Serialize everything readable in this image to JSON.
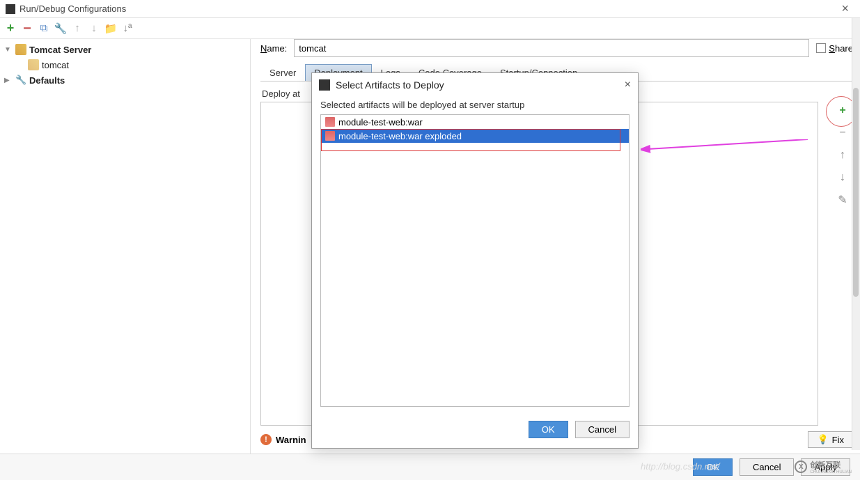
{
  "window": {
    "title": "Run/Debug Configurations"
  },
  "tree": {
    "tomcat_server": "Tomcat Server",
    "tomcat_child": "tomcat",
    "defaults": "Defaults"
  },
  "form": {
    "name_label": "Name:",
    "name_value": "tomcat",
    "share_label": "Share"
  },
  "tabs": {
    "server": "Server",
    "deployment": "Deployment",
    "logs": "Logs",
    "code_coverage": "Code Coverage",
    "startup": "Startup/Connection"
  },
  "deploy": {
    "section_label": "Deploy at"
  },
  "warning": {
    "label": "Warnin",
    "fix": "Fix"
  },
  "bottom": {
    "ok": "OK",
    "cancel": "Cancel",
    "apply": "Apply"
  },
  "modal": {
    "title": "Select Artifacts to Deploy",
    "hint": "Selected artifacts will be deployed at server startup",
    "items": [
      "module-test-web:war",
      "module-test-web:war exploded"
    ],
    "ok": "OK",
    "cancel": "Cancel"
  },
  "watermark": {
    "brand": "创新互联",
    "sub": "CHUANGXIN HULIAN"
  },
  "ghost_url": "http://blog.csdn.net/"
}
